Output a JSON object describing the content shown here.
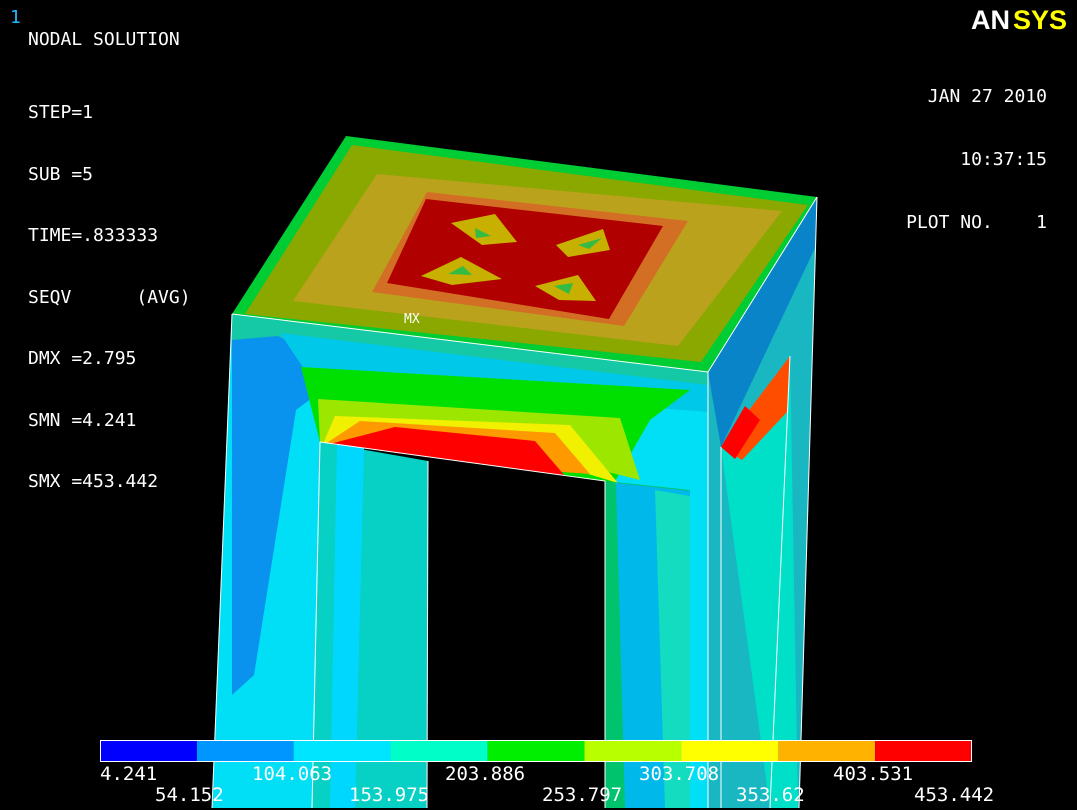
{
  "window_number": "1",
  "title": "NODAL SOLUTION",
  "solution_info": [
    "STEP=1",
    "SUB =5",
    "TIME=.833333",
    "SEQV      (AVG)",
    "DMX =2.795",
    "SMN =4.241",
    "SMX =453.442"
  ],
  "date": "JAN 27 2010",
  "time": "10:37:15",
  "plot_no": "PLOT NO.    1",
  "logo": {
    "an": "AN",
    "sys": "SYS",
    "an_color": "#ffffff",
    "sys_color": "#ffff00"
  },
  "max_marker": "MX",
  "legend": {
    "colors": [
      "#0000ff",
      "#0096ff",
      "#00e5ff",
      "#00ffc8",
      "#00ee00",
      "#b8ff00",
      "#ffff00",
      "#ffb300",
      "#ff0000"
    ],
    "labels": [
      "4.241",
      "54.152",
      "104.063",
      "153.975",
      "203.886",
      "253.797",
      "303.708",
      "353.62",
      "403.531",
      "453.442"
    ]
  }
}
